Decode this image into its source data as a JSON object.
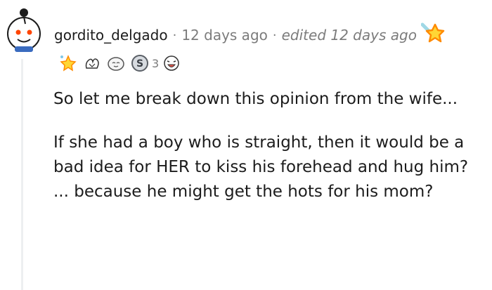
{
  "comment": {
    "username": "gordito_delgado",
    "separator": "·",
    "posted_time": "12 days ago",
    "edited_label": "edited 12 days ago",
    "header_award_icon": "star-icon",
    "awards": [
      {
        "icon": "sparkle-star-icon"
      },
      {
        "icon": "wholesome-hands-icon"
      },
      {
        "icon": "ghost-face-icon"
      },
      {
        "icon": "silver-coin-icon",
        "count": "3"
      },
      {
        "icon": "laughing-face-icon"
      }
    ],
    "paragraphs": [
      "So let me break down this opinion from the wife...",
      "If she had a boy who is straight, then it would be a bad idea for HER to kiss his forehead and hug him? ... because he might get the hots for his mom?"
    ]
  }
}
